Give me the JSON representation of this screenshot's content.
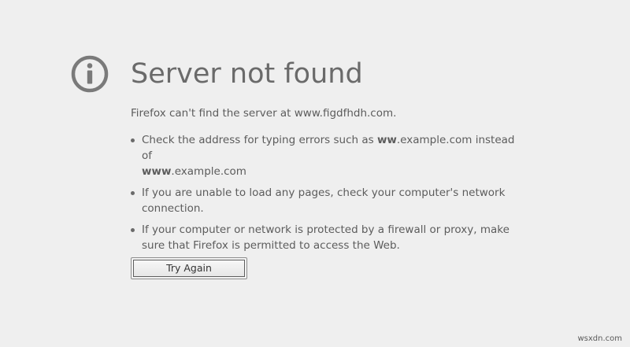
{
  "error": {
    "icon": "info-icon",
    "title": "Server not found",
    "short_desc": "Firefox can't find the server at www.figdfhdh.com.",
    "suggestions": [
      {
        "before": "Check the address for typing errors such as ",
        "bold1": "ww",
        "middle": ".example.com instead of ",
        "bold2": "www",
        "after": ".example.com"
      },
      {
        "text": "If you are unable to load any pages, check your computer's network connection."
      },
      {
        "text": "If your computer or network is protected by a firewall or proxy, make sure that Firefox is permitted to access the Web."
      }
    ],
    "try_again_label": "Try Again"
  },
  "watermark": "wsxdn.com",
  "colors": {
    "background": "#efefef",
    "title": "#6a6a6a",
    "text": "#5c5c5c",
    "button_border": "#5e5e5e"
  }
}
